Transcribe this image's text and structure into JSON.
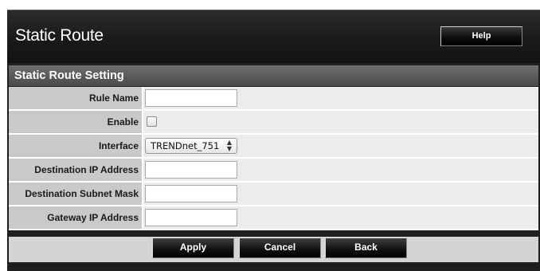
{
  "header": {
    "title": "Static Route",
    "help_label": "Help"
  },
  "section": {
    "title": "Static Route Setting"
  },
  "form": {
    "rule_name": {
      "label": "Rule Name",
      "value": ""
    },
    "enable": {
      "label": "Enable",
      "checked": false
    },
    "interface": {
      "label": "Interface",
      "value": "TRENDnet_751"
    },
    "destination_ip": {
      "label": "Destination IP Address",
      "value": ""
    },
    "destination_mask": {
      "label": "Destination Subnet Mask",
      "value": ""
    },
    "gateway_ip": {
      "label": "Gateway IP Address",
      "value": ""
    }
  },
  "buttons": {
    "apply": "Apply",
    "cancel": "Cancel",
    "back": "Back"
  },
  "icons": {
    "select_arrows": "up-down-chevron-icon",
    "checkbox": "checkbox-unchecked"
  }
}
